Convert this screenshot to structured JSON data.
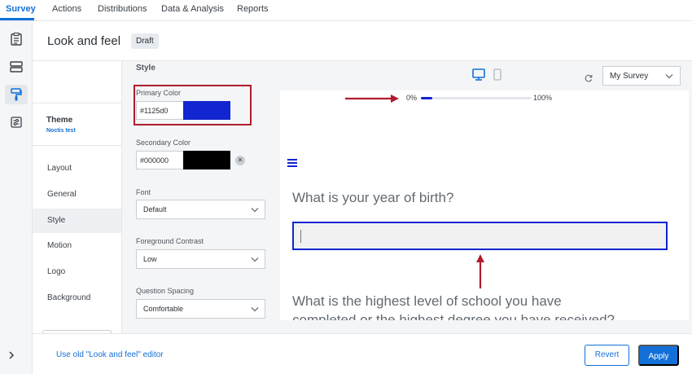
{
  "nav": {
    "tabs": [
      {
        "label": "Survey",
        "active": true
      },
      {
        "label": "Actions"
      },
      {
        "label": "Distributions"
      },
      {
        "label": "Data & Analysis"
      },
      {
        "label": "Reports"
      }
    ]
  },
  "rail": {
    "icons": [
      "survey-clipboard-icon",
      "layout-list-icon",
      "paint-roller-icon",
      "sliders-icon"
    ],
    "active_index": 2,
    "expand_icon": "chevron-right-icon"
  },
  "header": {
    "title": "Look and feel",
    "status": "Draft"
  },
  "menu": {
    "theme_label": "Theme",
    "theme_name": "Noctis test",
    "items": [
      {
        "label": "Layout"
      },
      {
        "label": "General"
      },
      {
        "label": "Style",
        "active": true
      },
      {
        "label": "Motion"
      },
      {
        "label": "Logo"
      },
      {
        "label": "Background"
      }
    ]
  },
  "style_panel": {
    "heading": "Style",
    "primary_color": {
      "label": "Primary Color",
      "value": "#1125d0",
      "swatch": "#1125d0"
    },
    "secondary_color": {
      "label": "Secondary Color",
      "value": "#000000",
      "swatch": "#000000",
      "clear": "✕"
    },
    "font": {
      "label": "Font",
      "value": "Default"
    },
    "foreground_contrast": {
      "label": "Foreground Contrast",
      "value": "Low"
    },
    "question_spacing": {
      "label": "Question Spacing",
      "value": "Comfortable"
    }
  },
  "preview_controls": {
    "devices": [
      "desktop-icon",
      "mobile-icon"
    ],
    "active_device": "desktop-icon",
    "survey_select": "My Survey"
  },
  "preview": {
    "progress": {
      "start_label": "0%",
      "end_label": "100%",
      "value_percent": 10
    },
    "questions": [
      {
        "text": "What is your year of birth?"
      },
      {
        "text": "What is the highest level of school you have",
        "text_line2": "completed or the highest degree you have received?"
      }
    ]
  },
  "annotations": {
    "color": "#b01c2e"
  },
  "footer": {
    "old_editor_link": "Use old \"Look and feel\" editor",
    "revert": "Revert",
    "apply": "Apply"
  },
  "colors": {
    "accent": "#1370d9",
    "primary_theme": "#1125d0"
  }
}
